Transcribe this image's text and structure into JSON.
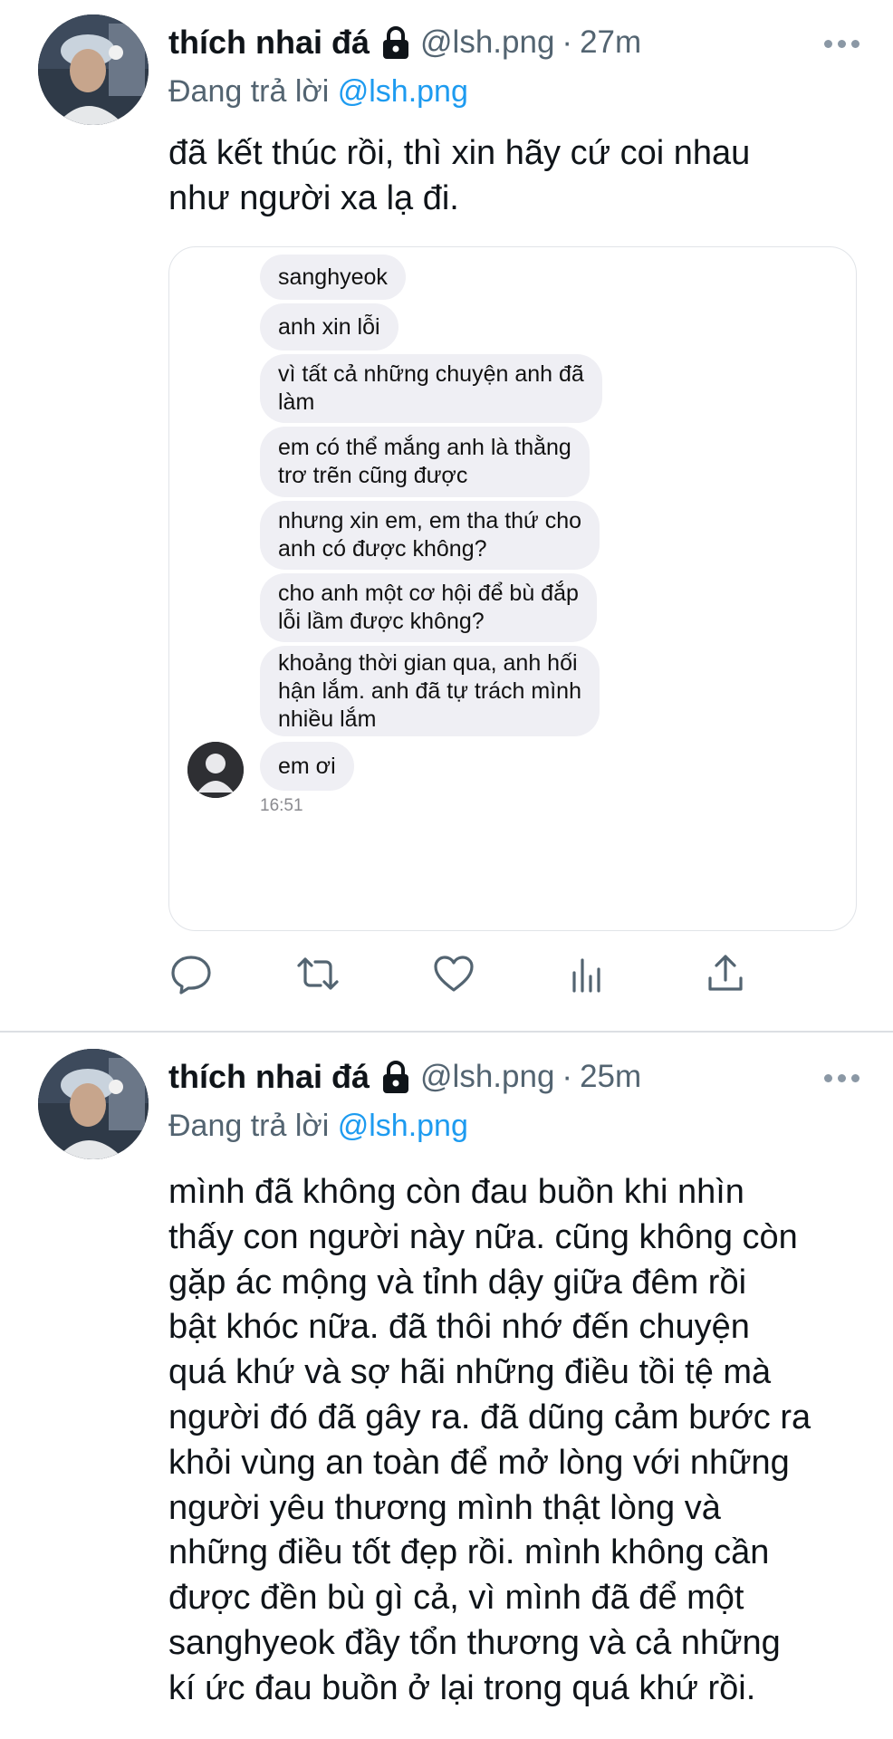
{
  "tweets": [
    {
      "display_name": "thích nhai đá",
      "handle": "@lsh.png",
      "separator": "·",
      "time": "27m",
      "replying_prefix": "Đang trả lời",
      "replying_to": "@lsh.png",
      "text_lines": [
        "đã kết thúc rồi, thì xin hãy cứ coi nhau",
        "như người xa lạ đi."
      ],
      "media": {
        "messages": [
          [
            "sanghyeok"
          ],
          [
            "anh xin lỗi"
          ],
          [
            "vì tất cả những chuyện anh đã",
            "làm"
          ],
          [
            "em có thể mắng anh là thằng",
            "trơ trẽn cũng được"
          ],
          [
            "nhưng xin em, em tha thứ cho",
            "anh có được không?"
          ],
          [
            "cho anh một cơ hội để bù đắp",
            "lỗi lầm được không?"
          ],
          [
            "khoảng thời gian qua, anh hối",
            "hận lắm. anh đã tự trách mình",
            "nhiều lắm"
          ],
          [
            "em ơi"
          ]
        ],
        "timestamp": "16:51"
      },
      "actions": [
        "reply-icon",
        "retweet-icon",
        "like-icon",
        "views-icon",
        "share-icon"
      ]
    },
    {
      "display_name": "thích nhai đá",
      "handle": "@lsh.png",
      "separator": "·",
      "time": "25m",
      "replying_prefix": "Đang trả lời",
      "replying_to": "@lsh.png",
      "text_lines": [
        "mình đã không còn đau buồn khi nhìn",
        "thấy con người này nữa. cũng không còn",
        "gặp ác mộng và tỉnh dậy giữa đêm rồi",
        "bật khóc nữa. đã thôi nhớ đến chuyện",
        "quá khứ và sợ hãi những điều tồi tệ mà",
        "người đó đã gây ra. đã dũng cảm bước ra",
        "khỏi vùng an toàn để mở lòng với những",
        "người yêu thương mình thật lòng và",
        "những điều tốt đẹp rồi. mình không cần",
        "được đền bù gì cả, vì mình đã để một",
        "sanghyeok đầy tổn thương và cả những",
        "kí ức đau buồn ở lại trong quá khứ rồi."
      ]
    }
  ],
  "colors": {
    "text": "#0f1419",
    "secondary": "#536471",
    "link": "#1d9bf0",
    "bubble": "#efeff4",
    "divider": "#dcdfe3"
  }
}
